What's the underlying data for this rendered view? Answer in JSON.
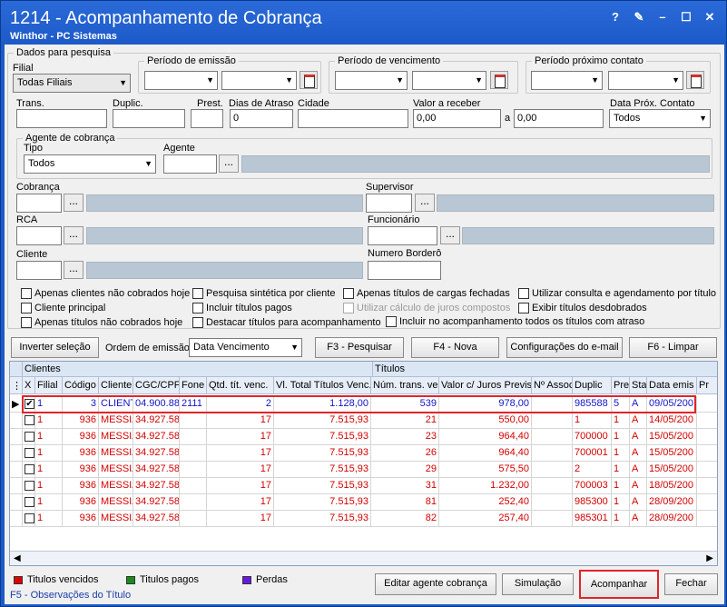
{
  "window": {
    "title": "1214 - Acompanhamento de Cobrança",
    "subtitle": "Winthor - PC Sistemas",
    "buttons": [
      "?",
      "✎",
      "–",
      "☐",
      "✕"
    ]
  },
  "filters": {
    "group_title": "Dados para pesquisa",
    "filial_label": "Filial",
    "filial_value": "Todas Filiais",
    "emissao_label": "Período de emissão",
    "vencimento_label": "Período de vencimento",
    "contato_label": "Período próximo contato",
    "trans_label": "Trans.",
    "duplic_label": "Duplic.",
    "prest_label": "Prest.",
    "dias_label": "Dias de Atraso",
    "dias_value": "0",
    "cidade_label": "Cidade",
    "valor_label": "Valor a receber",
    "valor_from": "0,00",
    "valor_a": "a",
    "valor_to": "0,00",
    "data_prox_label": "Data Próx. Contato",
    "data_prox_value": "Todos",
    "agente_group": "Agente de cobrança",
    "tipo_label": "Tipo",
    "tipo_value": "Todos",
    "agente_label": "Agente",
    "cobranca_label": "Cobrança",
    "supervisor_label": "Supervisor",
    "rca_label": "RCA",
    "funcionario_label": "Funcionário",
    "cliente_label": "Cliente",
    "bordero_label": "Numero Borderô",
    "dots": "..."
  },
  "checks": {
    "c1": "Apenas clientes não cobrados hoje",
    "c2": "Pesquisa sintética por cliente",
    "c3": "Apenas títulos de cargas fechadas",
    "c4": "Utilizar consulta e agendamento por título",
    "c5": "Cliente principal",
    "c6": "Incluir títulos pagos",
    "c7": "Utilizar cálculo de juros compostos",
    "c8": "Exibir títulos desdobrados",
    "c9": "Apenas títulos não cobrados hoje",
    "c10": "Destacar títulos para acompanhamento",
    "c11": "Incluir no acompanhamento todos os títulos com atraso"
  },
  "toolbar": {
    "inverter": "Inverter seleção",
    "ordem_label": "Ordem de emissão",
    "ordem_value": "Data Vencimento",
    "pesquisar": "F3 - Pesquisar",
    "nova": "F4 - Nova",
    "config": "Configurações do e-mail",
    "limpar": "F6 - Limpar"
  },
  "grid": {
    "band_clientes": "Clientes",
    "band_titulos": "Títulos",
    "columns": [
      "X",
      "Filial",
      "Código",
      "Cliente",
      "CGC/CPF",
      "Fone",
      "Qtd. tít. venc.",
      "Vl. Total Títulos Venc.",
      "Núm. trans. ve",
      "Valor c/ Juros Previs",
      "Nº Assoc",
      "Duplic",
      "Pre",
      "Sta",
      "Data emis",
      "Pr"
    ],
    "rows": [
      [
        "1",
        "3",
        "CLIENT",
        "04.900.88",
        "2111",
        "2",
        "1.128,00",
        "539",
        "978,00",
        "",
        "985588",
        "5",
        "A",
        "09/05/200"
      ],
      [
        "1",
        "936",
        "MESSIA",
        "34.927.58",
        "",
        "17",
        "7.515,93",
        "21",
        "550,00",
        "",
        "1",
        "1",
        "A",
        "14/05/200"
      ],
      [
        "1",
        "936",
        "MESSIA",
        "34.927.58",
        "",
        "17",
        "7.515,93",
        "23",
        "964,40",
        "",
        "700000",
        "1",
        "A",
        "15/05/200"
      ],
      [
        "1",
        "936",
        "MESSIA",
        "34.927.58",
        "",
        "17",
        "7.515,93",
        "26",
        "964,40",
        "",
        "700001",
        "1",
        "A",
        "15/05/200"
      ],
      [
        "1",
        "936",
        "MESSIA",
        "34.927.58",
        "",
        "17",
        "7.515,93",
        "29",
        "575,50",
        "",
        "2",
        "1",
        "A",
        "15/05/200"
      ],
      [
        "1",
        "936",
        "MESSIA",
        "34.927.58",
        "",
        "17",
        "7.515,93",
        "31",
        "1.232,00",
        "",
        "700003",
        "1",
        "A",
        "18/05/200"
      ],
      [
        "1",
        "936",
        "MESSIA",
        "34.927.58",
        "",
        "17",
        "7.515,93",
        "81",
        "252,40",
        "",
        "985300",
        "1",
        "A",
        "28/09/200"
      ],
      [
        "1",
        "936",
        "MESSIA",
        "34.927.58",
        "",
        "17",
        "7.515,93",
        "82",
        "257,40",
        "",
        "985301",
        "1",
        "A",
        "28/09/200"
      ]
    ]
  },
  "legend": {
    "vencidos": "Titulos vencidos",
    "pagos": "Titulos pagos",
    "perdas": "Perdas",
    "color_vencidos": "#e00000",
    "color_pagos": "#1a8a1a",
    "color_perdas": "#6a18e0"
  },
  "actions": {
    "editar": "Editar agente cobrança",
    "simulacao": "Simulação",
    "acompanhar": "Acompanhar",
    "fechar": "Fechar"
  },
  "status": "F5 - Observações do Título"
}
